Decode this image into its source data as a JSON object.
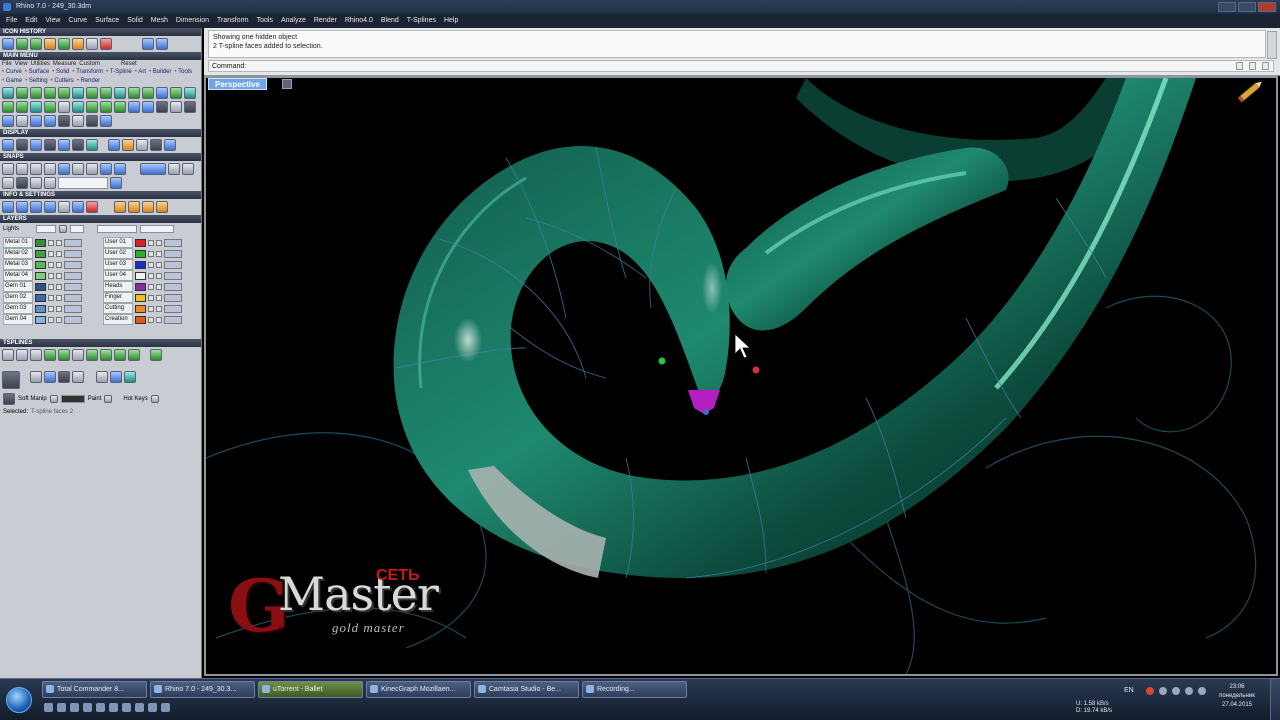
{
  "window": {
    "title": "Rhino 7.0 - 249_30.3dm"
  },
  "menu": [
    "File",
    "Edit",
    "View",
    "Curve",
    "Surface",
    "Solid",
    "Mesh",
    "Dimension",
    "Transform",
    "Tools",
    "Analyze",
    "Render",
    "Rhino4.0",
    "Blend",
    "T-Splines",
    "Help"
  ],
  "panel": {
    "icon_history": "ICON HISTORY",
    "main_menu": "MAIN MENU",
    "main_tabs": [
      "File",
      "View",
      "Utilities",
      "Measure",
      "Custom",
      "Reset"
    ],
    "sub_tabs": [
      "Curve",
      "Surface",
      "Solid",
      "Transform",
      "T-Spline",
      "Art",
      "Builder",
      "Tools",
      "Game",
      "Setting",
      "Cutters",
      "Render"
    ],
    "display": "DISPLAY",
    "snaps": "SNAPS",
    "info_settings": "INFO & SETTINGS",
    "layers_title": "LAYERS",
    "tsplines_title": "TSPLINES",
    "layers": {
      "lights_label": "Lights",
      "left": [
        {
          "name": "Metal 01",
          "color": "#3a8a3a"
        },
        {
          "name": "Metal 02",
          "color": "#3fa03f"
        },
        {
          "name": "Metal 03",
          "color": "#58b858"
        },
        {
          "name": "Metal 04",
          "color": "#7ccf7c"
        },
        {
          "name": "Gem 01",
          "color": "#2d4f8a"
        },
        {
          "name": "Gem 02",
          "color": "#3a68b0"
        },
        {
          "name": "Gem 03",
          "color": "#5a8ed0"
        },
        {
          "name": "Gem 04",
          "color": "#86b2e8"
        }
      ],
      "right": [
        {
          "name": "User 01",
          "color": "#d82020"
        },
        {
          "name": "User 02",
          "color": "#2cb02c"
        },
        {
          "name": "User 03",
          "color": "#1c2ad0"
        },
        {
          "name": "User 04",
          "color": "#f0f0f0"
        },
        {
          "name": "Heads",
          "color": "#8a2aa8"
        },
        {
          "name": "Finger",
          "color": "#f0c020"
        },
        {
          "name": "Cutting",
          "color": "#f08a20"
        },
        {
          "name": "Creation",
          "color": "#e05a10"
        }
      ]
    },
    "tsp": {
      "soft_manip": "Soft Manip",
      "paint": "Paint",
      "hot_keys": "Hot Keys",
      "selected_label": "Selected:",
      "selected_value": "T-spline faces 2"
    }
  },
  "command": {
    "history_line1": "Showing one hidden object",
    "history_line2": "2 T-spline faces added to selection.",
    "prompt": "Command:"
  },
  "viewport": {
    "tab": "Perspective"
  },
  "logo": {
    "g": "G",
    "master": "Master",
    "set": "СЕТЬ",
    "slogan": "gold master"
  },
  "taskbar": {
    "tasks": [
      {
        "label": "Total Commander 8...",
        "active": false
      },
      {
        "label": "Rhino 7.0 - 249_30.3...",
        "active": false
      },
      {
        "label": "uTorrent - Ballet",
        "active": true
      },
      {
        "label": "KinecGraph Mozillaen...",
        "active": false
      },
      {
        "label": "Camtasia Studio - Be...",
        "active": false
      },
      {
        "label": "Recording...",
        "active": false
      }
    ],
    "lang": "EN",
    "net_up": "U:   1.58 kB/s",
    "net_down": "D:   19.74 kB/s",
    "time": "23:06",
    "day": "понедельник",
    "date": "27.04.2015"
  }
}
